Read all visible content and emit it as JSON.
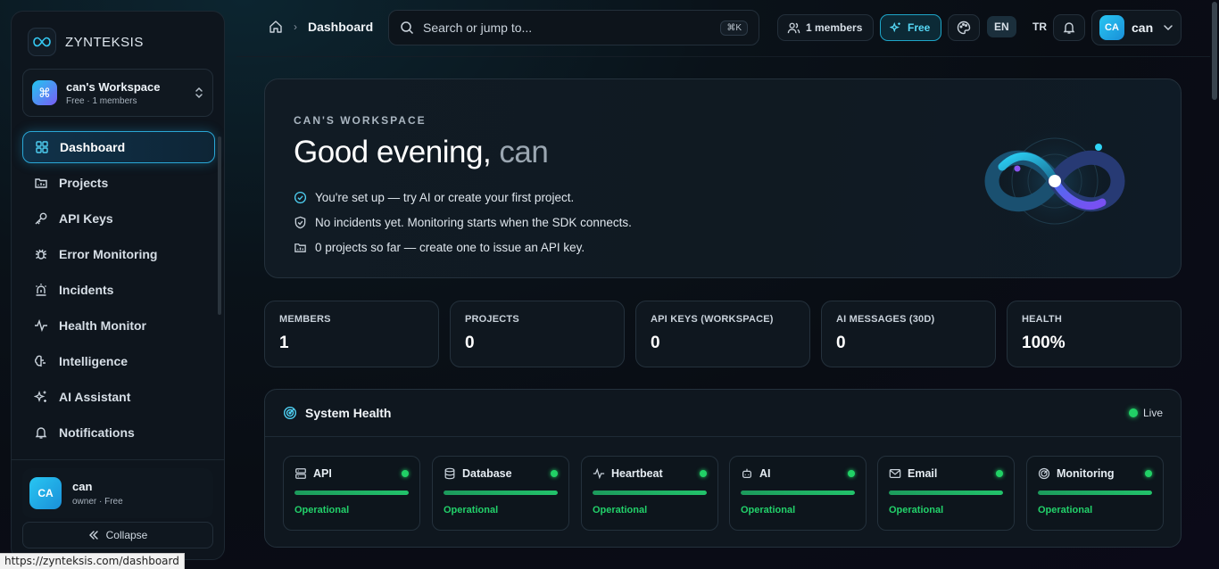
{
  "app": {
    "brand": "ZYNTEKSIS"
  },
  "workspace": {
    "name": "can's Workspace",
    "sub": "Free · 1 members"
  },
  "sidebar": {
    "items": [
      {
        "label": "Dashboard",
        "icon": "dashboard-icon",
        "active": true
      },
      {
        "label": "Projects",
        "icon": "projects-icon"
      },
      {
        "label": "API Keys",
        "icon": "key-icon"
      },
      {
        "label": "Error Monitoring",
        "icon": "bug-icon"
      },
      {
        "label": "Incidents",
        "icon": "siren-icon"
      },
      {
        "label": "Health Monitor",
        "icon": "pulse-icon"
      },
      {
        "label": "Intelligence",
        "icon": "brain-icon"
      },
      {
        "label": "AI Assistant",
        "icon": "sparkles-icon"
      },
      {
        "label": "Notifications",
        "icon": "bell-icon"
      }
    ],
    "user": {
      "initials": "CA",
      "name": "can",
      "role": "owner · Free"
    },
    "collapse_label": "Collapse"
  },
  "topbar": {
    "breadcrumb": "Dashboard",
    "search_placeholder": "Search or jump to...",
    "search_shortcut": "⌘K",
    "members": "1 members",
    "plan": "Free",
    "lang_en": "EN",
    "lang_tr": "TR",
    "user_initials": "CA",
    "user_name": "can"
  },
  "hero": {
    "eyebrow": "CAN'S WORKSPACE",
    "greeting": "Good evening,",
    "name": "can",
    "lines": [
      "You're set up — try AI or create your first project.",
      "No incidents yet. Monitoring starts when the SDK connects.",
      "0 projects so far — create one to issue an API key."
    ]
  },
  "stats": [
    {
      "label": "MEMBERS",
      "value": "1"
    },
    {
      "label": "PROJECTS",
      "value": "0"
    },
    {
      "label": "API KEYS (WORKSPACE)",
      "value": "0"
    },
    {
      "label": "AI MESSAGES (30D)",
      "value": "0"
    },
    {
      "label": "HEALTH",
      "value": "100%"
    }
  ],
  "health": {
    "title": "System Health",
    "live_label": "Live",
    "services": [
      {
        "name": "API",
        "icon": "server-icon",
        "status": "Operational",
        "level": 1.0
      },
      {
        "name": "Database",
        "icon": "database-icon",
        "status": "Operational",
        "level": 1.0
      },
      {
        "name": "Heartbeat",
        "icon": "heartbeat-icon",
        "status": "Operational",
        "level": 1.0
      },
      {
        "name": "AI",
        "icon": "bot-icon",
        "status": "Operational",
        "level": 1.0
      },
      {
        "name": "Email",
        "icon": "mail-icon",
        "status": "Operational",
        "level": 1.0
      },
      {
        "name": "Monitoring",
        "icon": "radar-icon",
        "status": "Operational",
        "level": 1.0
      }
    ]
  },
  "status_url": "https://zynteksis.com/dashboard",
  "colors": {
    "accent": "#22c7f0",
    "success": "#21d166",
    "violet": "#7a5cf5"
  }
}
